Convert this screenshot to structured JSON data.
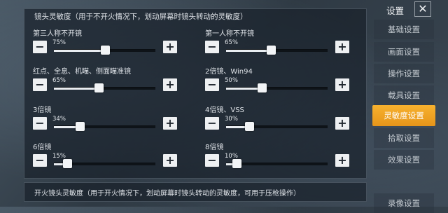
{
  "panel": {
    "header": "镜头灵敏度（用于不开火情况下，划动屏幕时镜头转动的灵敏度）"
  },
  "sliders": [
    {
      "label": "第三人称不开镜",
      "value_text": "75%",
      "value": 75
    },
    {
      "label": "第一人称不开镜",
      "value_text": "65%",
      "value": 65
    },
    {
      "label": "红点、全息、机瞄、侧面瞄准镜",
      "value_text": "65%",
      "value": 65
    },
    {
      "label": "2倍镜、Win94",
      "value_text": "50%",
      "value": 50
    },
    {
      "label": "3倍镜",
      "value_text": "34%",
      "value": 34
    },
    {
      "label": "4倍镜、VSS",
      "value_text": "30%",
      "value": 30
    },
    {
      "label": "6倍镜",
      "value_text": "15%",
      "value": 15
    },
    {
      "label": "8倍镜",
      "value_text": "10%",
      "value": 10
    }
  ],
  "controls": {
    "minus": "−",
    "plus": "+"
  },
  "footer": {
    "text": "开火镜头灵敏度（用于开火情况下，划动屏幕时镜头转动的灵敏度，可用于压枪操作）"
  },
  "sidebar": {
    "title": "设置",
    "close": "✕",
    "items": [
      {
        "label": "基础设置",
        "active": false
      },
      {
        "label": "画面设置",
        "active": false
      },
      {
        "label": "操作设置",
        "active": false
      },
      {
        "label": "载具设置",
        "active": false
      },
      {
        "label": "灵敏度设置",
        "active": true
      },
      {
        "label": "拾取设置",
        "active": false
      },
      {
        "label": "效果设置",
        "active": false
      },
      {
        "label": "录像设置",
        "active": false
      }
    ]
  },
  "colors": {
    "accent": "#f0a424",
    "panel_bg": "#19212b"
  }
}
